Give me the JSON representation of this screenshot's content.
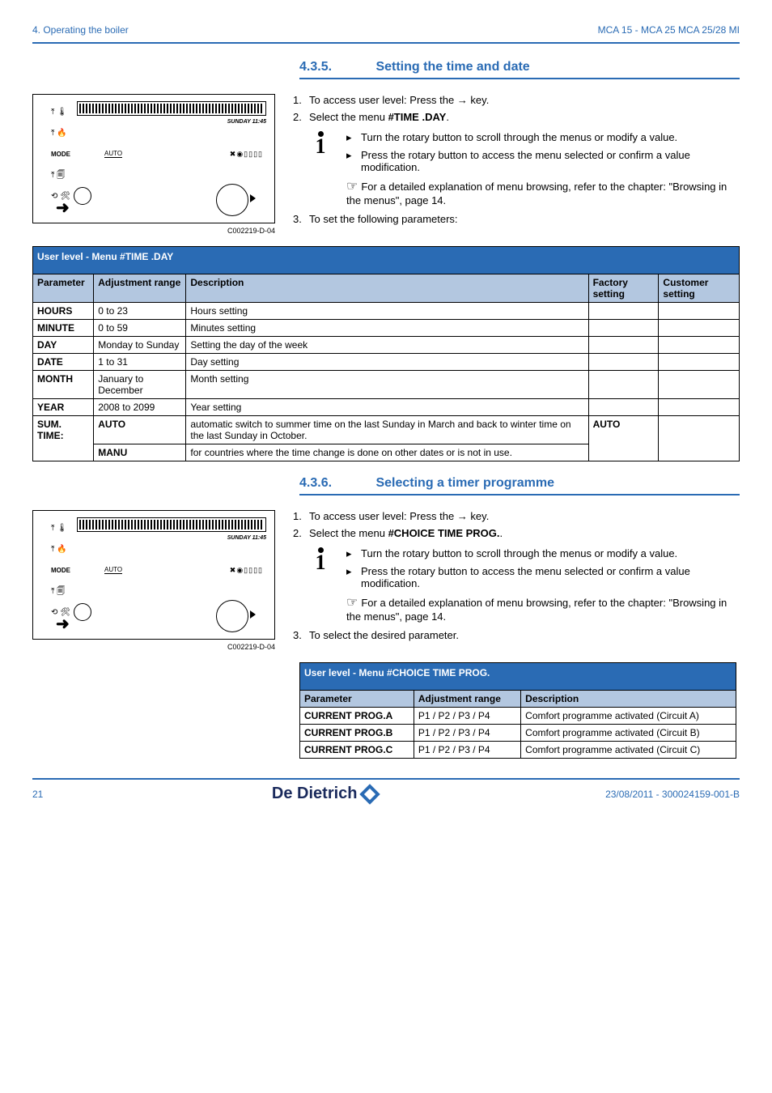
{
  "header": {
    "left": "4.  Operating the boiler",
    "right": "MCA 15 - MCA 25 MCA 25/28 MI"
  },
  "section1": {
    "number": "4.3.5.",
    "title": "Setting the time and date",
    "step1_prefix": "To access user level: Press the ",
    "step1_suffix": " key.",
    "step2_prefix": "Select the menu ",
    "step2_menu": "#TIME .DAY",
    "step2_suffix": ".",
    "info_bullet1": "Turn the rotary button to scroll through the menus or modify a value.",
    "info_bullet2": "Press the rotary button to access the menu selected or confirm a value modification.",
    "info_ref": "For a detailed explanation of menu browsing, refer to the chapter:  \"Browsing in the menus\", page 14.",
    "step3": "To set the following parameters:",
    "fig_caption": "C002219-D-04",
    "lcd_day": "SUNDAY 11:45",
    "lcd_auto": "AUTO",
    "lcd_mode": "MODE"
  },
  "table1": {
    "title": "User level - Menu #TIME .DAY",
    "headers": {
      "p": "Parameter",
      "r": "Adjustment range",
      "d": "Description",
      "f": "Factory setting",
      "c": "Customer setting"
    },
    "rows": [
      {
        "p": "HOURS",
        "r": "0 to 23",
        "d": "Hours setting",
        "f": "",
        "c": ""
      },
      {
        "p": "MINUTE",
        "r": "0 to 59",
        "d": "Minutes setting",
        "f": "",
        "c": ""
      },
      {
        "p": "DAY",
        "r": "Monday to Sunday",
        "d": "Setting the day of the week",
        "f": "",
        "c": ""
      },
      {
        "p": "DATE",
        "r": "1 to 31",
        "d": "Day setting",
        "f": "",
        "c": ""
      },
      {
        "p": "MONTH",
        "r": "January to December",
        "d": "Month setting",
        "f": "",
        "c": ""
      },
      {
        "p": "YEAR",
        "r": "2008 to 2099",
        "d": "Year setting",
        "f": "",
        "c": ""
      }
    ],
    "sum_label": "SUM. TIME:",
    "sum_auto_r": "AUTO",
    "sum_auto_d": "automatic switch to summer time on the last Sunday in March and back to winter time on the last Sunday in October.",
    "sum_auto_f": "AUTO",
    "sum_manu_r": "MANU",
    "sum_manu_d": "for countries where the time change is done on other dates or is not in use."
  },
  "section2": {
    "number": "4.3.6.",
    "title": "Selecting a timer programme",
    "step1_prefix": "To access user level: Press the ",
    "step1_suffix": " key.",
    "step2_prefix": "Select the menu ",
    "step2_menu": "#CHOICE TIME PROG.",
    "step2_suffix": ".",
    "info_bullet1": "Turn the rotary button to scroll through the menus or modify a value.",
    "info_bullet2": "Press the rotary button to access the menu selected or confirm a value modification.",
    "info_ref": "For a detailed explanation of menu browsing, refer to the chapter:  \"Browsing in the menus\", page 14.",
    "step3": "To select the desired parameter.",
    "fig_caption": "C002219-D-04",
    "lcd_day": "SUNDAY 11:45",
    "lcd_auto": "AUTO",
    "lcd_mode": "MODE"
  },
  "table2": {
    "title": "User level - Menu #CHOICE TIME PROG.",
    "headers": {
      "p": "Parameter",
      "r": "Adjustment range",
      "d": "Description"
    },
    "rows": [
      {
        "p": "CURRENT PROG.A",
        "r": "P1 / P2 / P3 / P4",
        "d": "Comfort programme activated (Circuit A)"
      },
      {
        "p": "CURRENT PROG.B",
        "r": "P1 / P2 / P3 / P4",
        "d": "Comfort programme activated (Circuit B)"
      },
      {
        "p": "CURRENT PROG.C",
        "r": "P1 / P2 / P3 / P4",
        "d": "Comfort programme activated (Circuit C)"
      }
    ]
  },
  "footer": {
    "page": "21",
    "brand": "De Dietrich",
    "date_ref": "23/08/2011  - 300024159-001-B"
  }
}
